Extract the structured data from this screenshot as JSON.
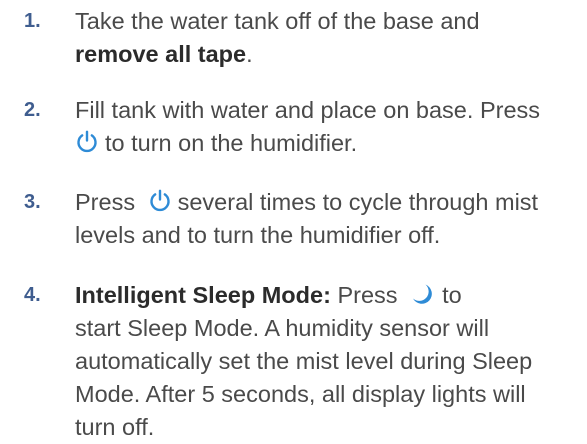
{
  "steps": [
    {
      "number": "1.",
      "line1": "Take the water tank off of the base and",
      "bold": "remove all tape",
      "after_bold": "."
    },
    {
      "number": "2.",
      "line1": "Fill tank with water and place on base. Press",
      "after_icon": "to turn on the humidifier.",
      "icon": "power-icon"
    },
    {
      "number": "3.",
      "before_icon": "Press",
      "after_icon": "several times to cycle through mist",
      "line2": "levels and to turn the humidifier off.",
      "icon": "power-icon"
    },
    {
      "number": "4.",
      "bold": "Intelligent Sleep Mode:",
      "before_icon": "Press",
      "after_icon": "to",
      "icon": "moon-icon",
      "line2": "start Sleep Mode. A humidity sensor will",
      "line3": "automatically set the mist level during Sleep",
      "line4": "Mode. After 5 seconds, all display lights will",
      "line5": "turn off."
    }
  ],
  "colors": {
    "number": "#3f5d8f",
    "icon": "#2e8bd6",
    "text": "#4a4a4a"
  }
}
